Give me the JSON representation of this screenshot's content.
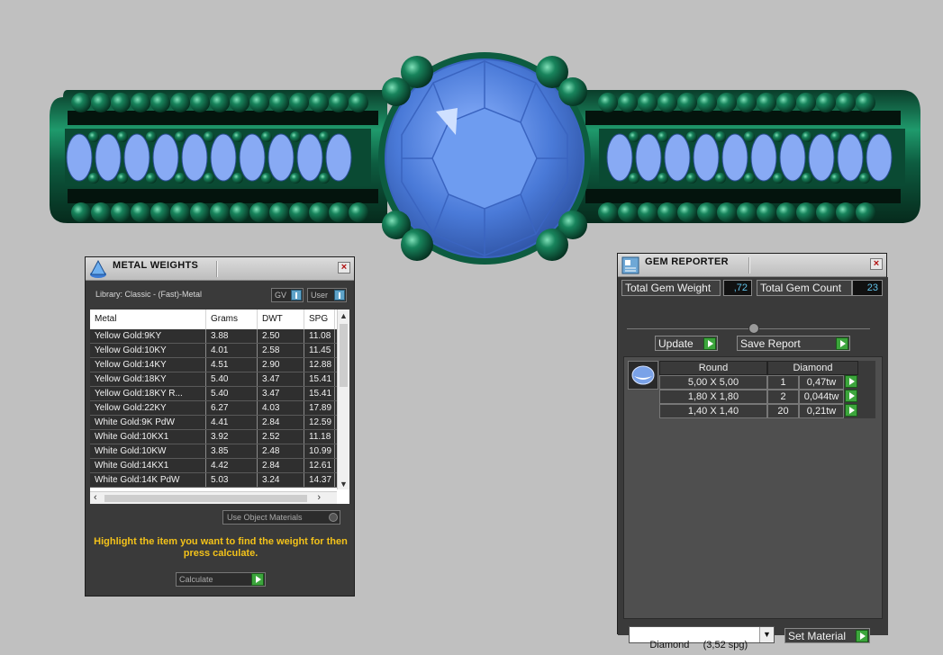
{
  "metal_weights": {
    "title": "METAL WEIGHTS",
    "library": "Library: Classic - (Fast)-Metal",
    "toggle_gv": "GV",
    "toggle_user": "User",
    "columns": [
      "Metal",
      "Grams",
      "DWT",
      "SPG"
    ],
    "rows": [
      [
        "Yellow Gold:9KY",
        "3.88",
        "2.50",
        "11.08"
      ],
      [
        "Yellow Gold:10KY",
        "4.01",
        "2.58",
        "11.45"
      ],
      [
        "Yellow Gold:14KY",
        "4.51",
        "2.90",
        "12.88"
      ],
      [
        "Yellow Gold:18KY",
        "5.40",
        "3.47",
        "15.41"
      ],
      [
        "Yellow Gold:18KY R...",
        "5.40",
        "3.47",
        "15.41"
      ],
      [
        "Yellow Gold:22KY",
        "6.27",
        "4.03",
        "17.89"
      ],
      [
        "White Gold:9K PdW",
        "4.41",
        "2.84",
        "12.59"
      ],
      [
        "White Gold:10KX1",
        "3.92",
        "2.52",
        "11.18"
      ],
      [
        "White Gold:10KW",
        "3.85",
        "2.48",
        "10.99"
      ],
      [
        "White Gold:14KX1",
        "4.42",
        "2.84",
        "12.61"
      ],
      [
        "White Gold:14K PdW",
        "5.03",
        "3.24",
        "14.37"
      ]
    ],
    "use_object_materials": "Use Object Materials",
    "hint": "Highlight the item you want to find the weight for then press calculate.",
    "calculate": "Calculate"
  },
  "gem_reporter": {
    "title": "GEM REPORTER",
    "total_weight_label": "Total Gem Weight",
    "total_weight_value": ",72",
    "total_count_label": "Total Gem Count",
    "total_count_value": "23",
    "update_label": "Update",
    "save_label": "Save Report",
    "shape_header": "Round",
    "material_header": "Diamond",
    "gems": [
      {
        "size": "5,00 X 5,00",
        "count": "1",
        "weight": "0,47tw"
      },
      {
        "size": "1,80 X 1,80",
        "count": "2",
        "weight": "0,044tw"
      },
      {
        "size": "1,40 X 1,40",
        "count": "20",
        "weight": "0,21tw"
      }
    ],
    "material_select": "Diamond     (3,52 spg)",
    "set_material": "Set Material"
  },
  "colors": {
    "metal": "#0f6e4e",
    "gem": "#5f8fe0",
    "accent_value": "#5fc1e8",
    "hint": "#f3c21a",
    "go_button": "#3ca53c"
  }
}
